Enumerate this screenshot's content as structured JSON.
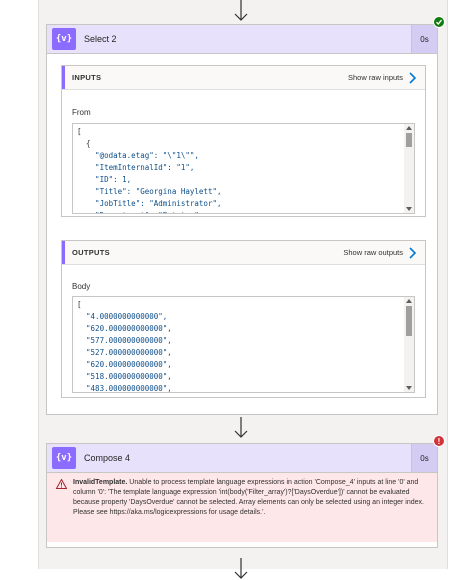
{
  "select_action": {
    "title": "Select 2",
    "duration": "0s",
    "status": "succeeded",
    "icon": "data-operation-icon",
    "inputs": {
      "section_title": "INPUTS",
      "raw_link": "Show raw inputs",
      "field_label": "From",
      "code_lines": [
        "[",
        "  {",
        "    \"@odata.etag\": \"\\\"1\\\"\",",
        "    \"ItemInternalId\": \"1\",",
        "    \"ID\": 1,",
        "    \"Title\": \"Georgina Haylett\",",
        "    \"JobTitle\": \"Administrator\",",
        "    \"Department\": \"Estates\","
      ]
    },
    "outputs": {
      "section_title": "OUTPUTS",
      "raw_link": "Show raw outputs",
      "field_label": "Body",
      "code_lines": [
        "[",
        "  \"4.0000000000000\",",
        "  \"620.000000000000\",",
        "  \"577.000000000000\",",
        "  \"527.000000000000\",",
        "  \"620.000000000000\",",
        "  \"518.000000000000\",",
        "  \"483.000000000000\","
      ]
    }
  },
  "compose_action": {
    "title": "Compose 4",
    "duration": "0s",
    "status": "failed",
    "icon": "data-operation-icon",
    "error": {
      "code": "InvalidTemplate.",
      "message": " Unable to process template language expressions in action 'Compose_4' inputs at line '0' and column '0': 'The template language expression 'int(body('Filter_array')?['DaysOverdue'])' cannot be evaluated because property 'DaysOverdue' cannot be selected. Array elements can only be selected using an integer index. Please see https://aka.ms/logicexpressions for usage details.'."
    }
  },
  "colors": {
    "accent": "#8c6cff",
    "header_bg": "#e7e1fb",
    "success": "#107c10",
    "error": "#d13438",
    "error_bg": "#fde7e9"
  }
}
